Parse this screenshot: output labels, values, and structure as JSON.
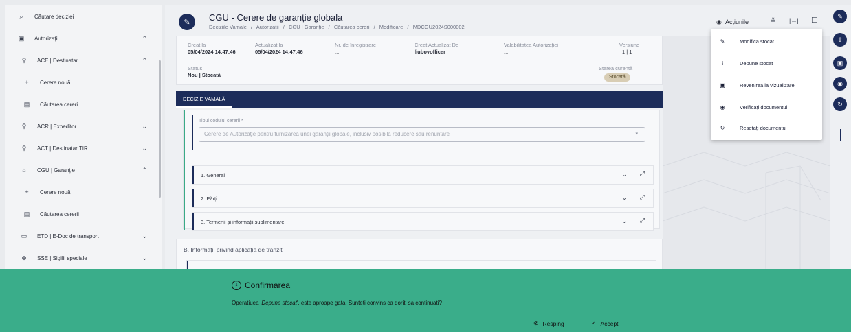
{
  "sidebar": {
    "items": [
      {
        "icon": "search-icon",
        "glyph": "⌕",
        "label": "Căutare deciziei",
        "chevron": ""
      },
      {
        "icon": "authorization-icon",
        "glyph": "▣",
        "label": "Autorizații",
        "chevron": "⌃"
      },
      {
        "icon": "consignee-icon",
        "glyph": "⚲",
        "label": "ACE | Destinatar",
        "chevron": "⌃"
      },
      {
        "icon": "plus-icon",
        "glyph": "+",
        "label": "Cerere nouă",
        "chevron": ""
      },
      {
        "icon": "document-search-icon",
        "glyph": "▤",
        "label": "Căutarea cereri",
        "chevron": ""
      },
      {
        "icon": "consignor-icon",
        "glyph": "⚲",
        "label": "ACR | Expeditor",
        "chevron": "⌄"
      },
      {
        "icon": "tir-icon",
        "glyph": "⚲",
        "label": "ACT | Destinatar TIR",
        "chevron": "⌄"
      },
      {
        "icon": "bank-icon",
        "glyph": "⌂",
        "label": "CGU | Garanție",
        "chevron": "⌃"
      },
      {
        "icon": "plus-icon",
        "glyph": "+",
        "label": "Cerere nouă",
        "chevron": ""
      },
      {
        "icon": "document-search-icon",
        "glyph": "▤",
        "label": "Căutarea cererii",
        "chevron": ""
      },
      {
        "icon": "transport-doc-icon",
        "glyph": "▭",
        "label": "ETD | E-Doc de transport",
        "chevron": "⌄"
      },
      {
        "icon": "lock-icon",
        "glyph": "⊕",
        "label": "SSE | Sigilii speciale",
        "chevron": "⌄"
      }
    ]
  },
  "header": {
    "title": "CGU - Cerere de garanție globala",
    "breadcrumb": [
      "Deciziile Vamale",
      "/",
      "Autorizații",
      "/",
      "CGU | Garanție",
      "/",
      "Căutarea cereri",
      "/",
      "Modificare",
      "/",
      "MDCGU2024S000002"
    ]
  },
  "info": {
    "created_label": "Creat la",
    "created_value": "05/04/2024 14:47:46",
    "updated_label": "Actualizat la",
    "updated_value": "05/04/2024 14:47:46",
    "regno_label": "Nr. de înregistrare",
    "regno_value": "...",
    "createdby_label": "Creat Actualizat De",
    "createdby_value": "liubovofficer",
    "validity_label": "Valabilitatea Autorizației",
    "validity_value": "...",
    "version_label": "Versiune",
    "version_value": "1 | 1",
    "status_label": "Status",
    "status_value": "Nou | Stocată",
    "state_label": "Starea curentă",
    "state_value": "Stocată"
  },
  "tabs": {
    "active": "DECIZIE VAMALĂ"
  },
  "form": {
    "field_label": "Tipul codului cererii *",
    "field_value": "Cerere de Autorizație pentru furnizarea unei garanții globale, inclusiv posibila reducere sau renuntare",
    "accordions": [
      "1. General",
      "2. Părți",
      "3. Termenii și informații suplimentare"
    ],
    "section_b_title": "B. Informații privind aplicația de tranzit"
  },
  "actions": {
    "label": "Acțiunile",
    "menu": [
      {
        "icon": "edit-stored-icon",
        "glyph": "✎",
        "label": "Modifica stocat"
      },
      {
        "icon": "submit-stored-icon",
        "glyph": "⇪",
        "label": "Depune stocat"
      },
      {
        "icon": "save-view-icon",
        "glyph": "▣",
        "label": "Revenirea la vizualizare"
      },
      {
        "icon": "eye-icon",
        "glyph": "◉",
        "label": "Verificați documentul"
      },
      {
        "icon": "reset-icon",
        "glyph": "↻",
        "label": "Resetați documentul"
      }
    ]
  },
  "confirm": {
    "title": "Confirmarea",
    "msg_prefix": "Operatiuea '",
    "msg_op": "Depune stocat",
    "msg_suffix": "'. este aproape gata. Sunteti convins ca doriti sa continuati?",
    "reject_label": "Resping",
    "accept_label": "Accept"
  },
  "colors": {
    "primary": "#1c2c5a",
    "banner": "#3aad8a",
    "badge": "#d8cdb4"
  }
}
